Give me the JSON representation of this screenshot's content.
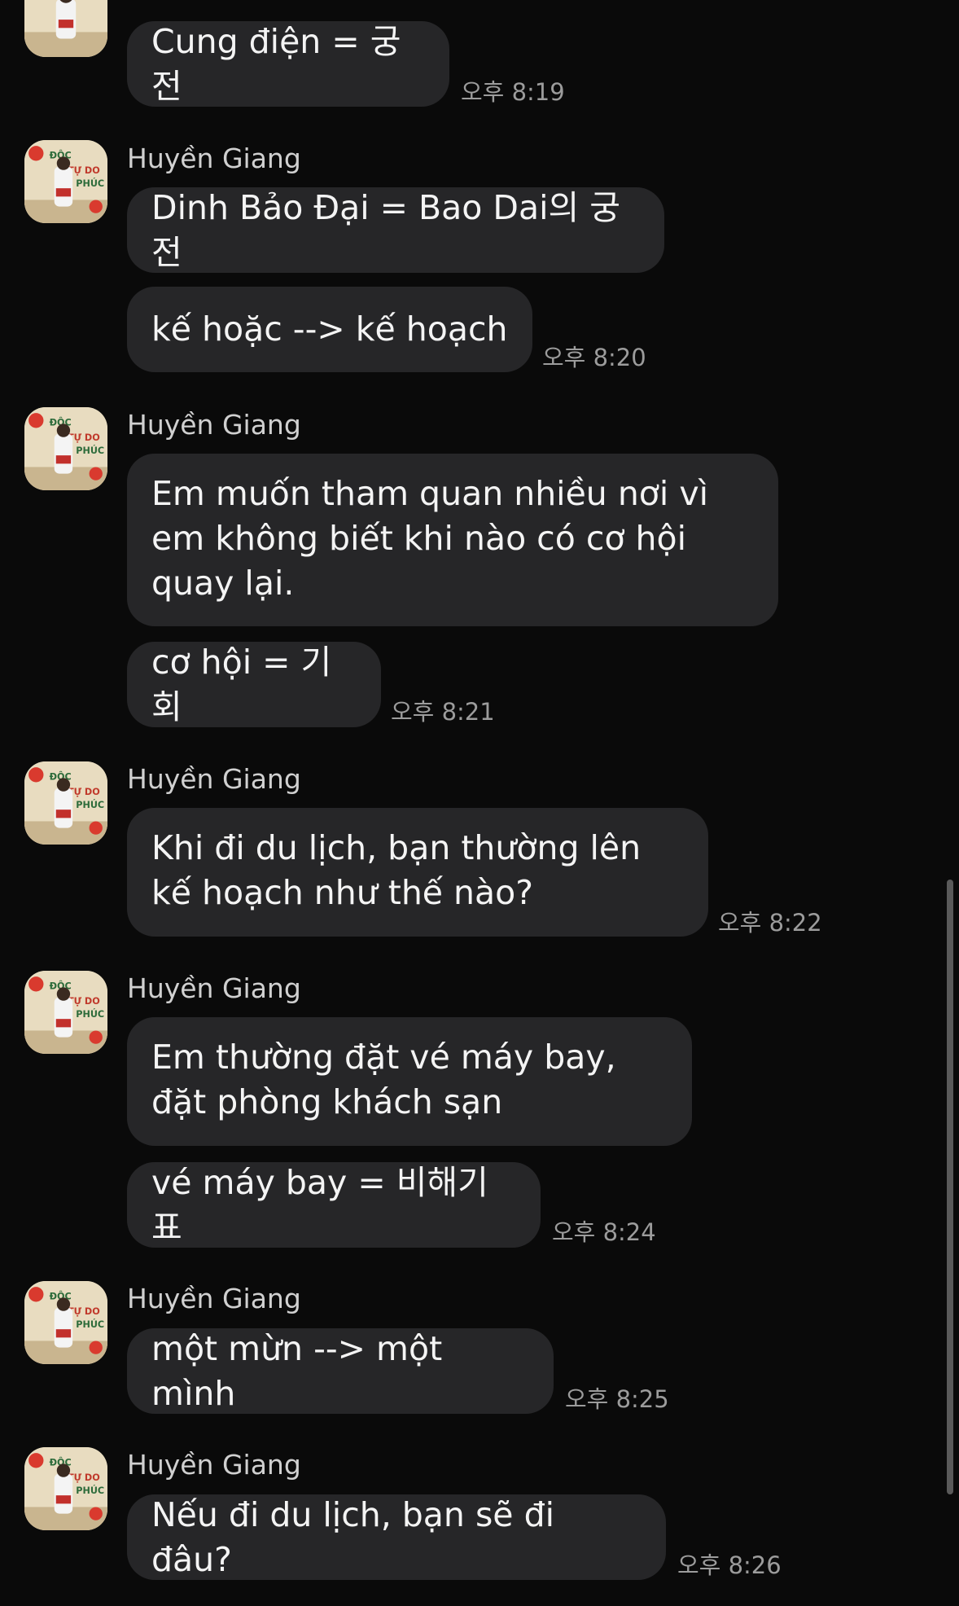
{
  "conversation": {
    "sender_name": "Huyền Giang",
    "messages": [
      {
        "text": "Cung điện = 궁전",
        "time": "오후 8:19"
      },
      {
        "text": "Dinh Bảo Đại = Bao Dai의 궁전"
      },
      {
        "text": "kế hoặc --> kế hoạch",
        "time": "오후 8:20"
      },
      {
        "text": "Em muốn tham quan nhiều nơi vì em không biết khi nào có cơ hội quay lại."
      },
      {
        "text": "cơ hội = 기회",
        "time": "오후 8:21"
      },
      {
        "text": "Khi đi du lịch, bạn thường lên kế hoạch như thế nào?",
        "time": "오후 8:22"
      },
      {
        "text": "Em thường đặt vé máy bay, đặt phòng khách sạn"
      },
      {
        "text": "vé máy bay = 비해기 표",
        "time": "오후 8:24"
      },
      {
        "text": "một mừn --> một mình",
        "time": "오후 8:25"
      },
      {
        "text": "Nếu đi du lịch, bạn sẽ đi đâu?",
        "time": "오후 8:26"
      }
    ]
  },
  "colors": {
    "background": "#0a0a0a",
    "bubble": "#262628",
    "timestamp": "#9c9c9c",
    "sender": "#d0d0d0"
  },
  "icons": {
    "avatar": "profile-photo-avatar"
  }
}
